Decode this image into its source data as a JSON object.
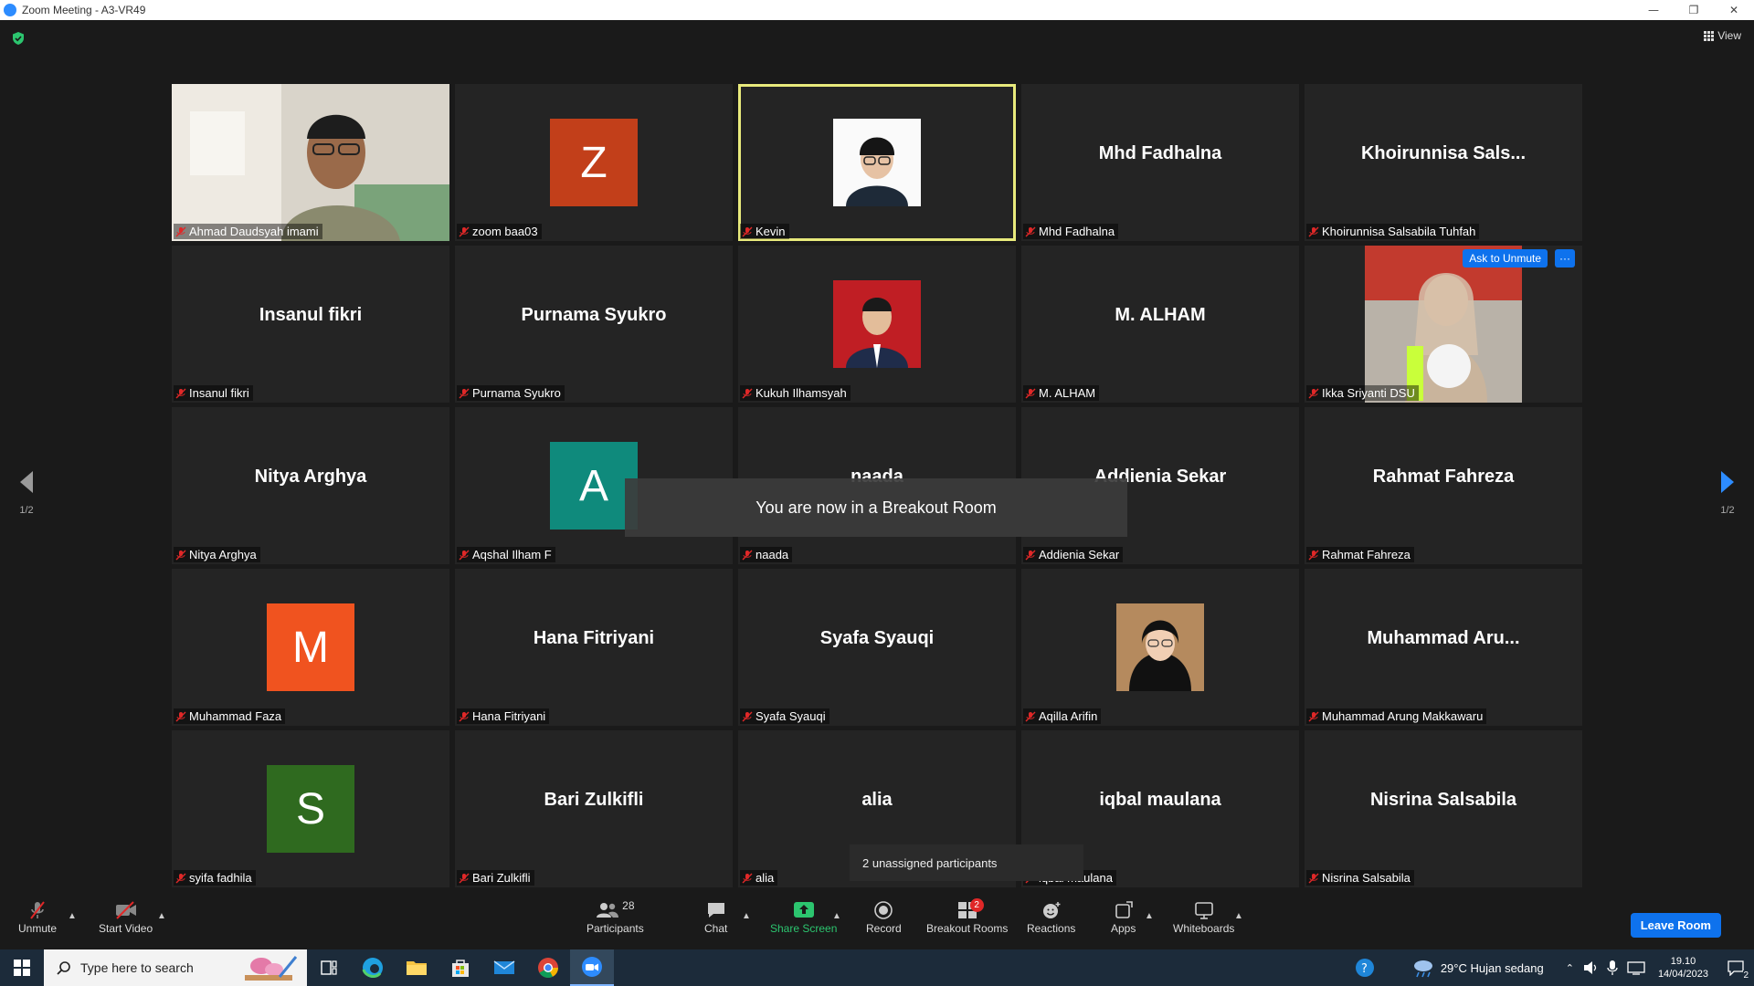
{
  "window": {
    "title": "Zoom Meeting - A3-VR49",
    "minimize": "—",
    "restore": "❐",
    "close": "✕"
  },
  "view_label": "View",
  "page": {
    "left_count": "1/2",
    "right_count": "1/2"
  },
  "tiles": [
    {
      "label": "Ahmad Daudsyah imami",
      "kind": "video"
    },
    {
      "label": "zoom baa03",
      "kind": "avatar",
      "letter": "Z",
      "color": "#c23f1a"
    },
    {
      "label": "Kevin",
      "kind": "photo",
      "active": true
    },
    {
      "label": "Mhd Fadhalna",
      "kind": "name",
      "display": "Mhd Fadhalna"
    },
    {
      "label": "Khoirunnisa Salsabila Tuhfah",
      "kind": "name",
      "display": "Khoirunnisa  Sals..."
    },
    {
      "label": "Insanul fikri",
      "kind": "name",
      "display": "Insanul fikri"
    },
    {
      "label": "Purnama Syukro",
      "kind": "name",
      "display": "Purnama Syukro"
    },
    {
      "label": "Kukuh Ilhamsyah",
      "kind": "photo-red"
    },
    {
      "label": "M. ALHAM",
      "kind": "name",
      "display": "M. ALHAM"
    },
    {
      "label": "Ikka Sriyanti DSU",
      "kind": "video-hijab",
      "ask": "Ask to Unmute",
      "more": "···"
    },
    {
      "label": "Nitya Arghya",
      "kind": "name",
      "display": "Nitya Arghya"
    },
    {
      "label": "Aqshal Ilham F",
      "kind": "avatar",
      "letter": "A",
      "color": "#0f8a7c"
    },
    {
      "label": "naada",
      "kind": "name",
      "display": "naada"
    },
    {
      "label": "Addienia Sekar",
      "kind": "name",
      "display": "Addienia Sekar"
    },
    {
      "label": "Rahmat Fahreza",
      "kind": "name",
      "display": "Rahmat Fahreza"
    },
    {
      "label": "Muhammad Faza",
      "kind": "avatar",
      "letter": "M",
      "color": "#f0531f"
    },
    {
      "label": "Hana Fitriyani",
      "kind": "name",
      "display": "Hana Fitriyani"
    },
    {
      "label": "Syafa Syauqi",
      "kind": "name",
      "display": "Syafa Syauqi"
    },
    {
      "label": "Aqilla Arifin",
      "kind": "photo-hijab"
    },
    {
      "label": "Muhammad Arung Makkawaru",
      "kind": "name",
      "display": "Muhammad  Aru..."
    },
    {
      "label": "syifa fadhila",
      "kind": "avatar",
      "letter": "S",
      "color": "#2f6a1f"
    },
    {
      "label": "Bari Zulkifli",
      "kind": "name",
      "display": "Bari Zulkifli"
    },
    {
      "label": "alia",
      "kind": "name",
      "display": "alia"
    },
    {
      "label": "iqbal maulana",
      "kind": "name",
      "display": "iqbal maulana"
    },
    {
      "label": "Nisrina Salsabila",
      "kind": "name",
      "display": "Nisrina Salsabila"
    }
  ],
  "toast": "You are now in a Breakout Room",
  "unassigned": "2 unassigned participants",
  "toolbar": {
    "unmute": "Unmute",
    "start_video": "Start Video",
    "participants": "Participants",
    "participants_count": "28",
    "chat": "Chat",
    "share_screen": "Share Screen",
    "record": "Record",
    "breakout_rooms": "Breakout Rooms",
    "breakout_badge": "2",
    "reactions": "Reactions",
    "apps": "Apps",
    "whiteboards": "Whiteboards",
    "leave": "Leave Room"
  },
  "taskbar": {
    "search_placeholder": "Type here to search",
    "weather": "29°C  Hujan sedang",
    "time": "19.10",
    "date": "14/04/2023",
    "notif_count": "2"
  },
  "colors": {
    "accent": "#0e72ed",
    "active_border": "#e8ea7c",
    "share_green": "#2cc56f",
    "muted_red": "#e02828"
  }
}
